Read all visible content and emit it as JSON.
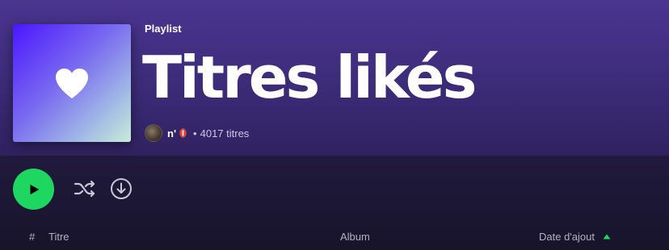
{
  "playlist": {
    "type_label": "Playlist",
    "title": "Titres likés",
    "owner": "n'",
    "separator": "•",
    "track_count": "4017 titres"
  },
  "icons": {
    "cover": "heart-icon",
    "owner_avatar": "avatar",
    "owner_badge": "rugby-ball-icon",
    "play": "play-icon",
    "shuffle": "shuffle-icon",
    "download": "download-icon",
    "sort": "sort-ascending-icon"
  },
  "table": {
    "columns": {
      "number": "#",
      "title": "Titre",
      "album": "Album",
      "date_added": "Date d'ajout"
    }
  },
  "colors": {
    "accent_green": "#1ed760",
    "header_purple": "#4a3590",
    "background": "#1c1733"
  }
}
